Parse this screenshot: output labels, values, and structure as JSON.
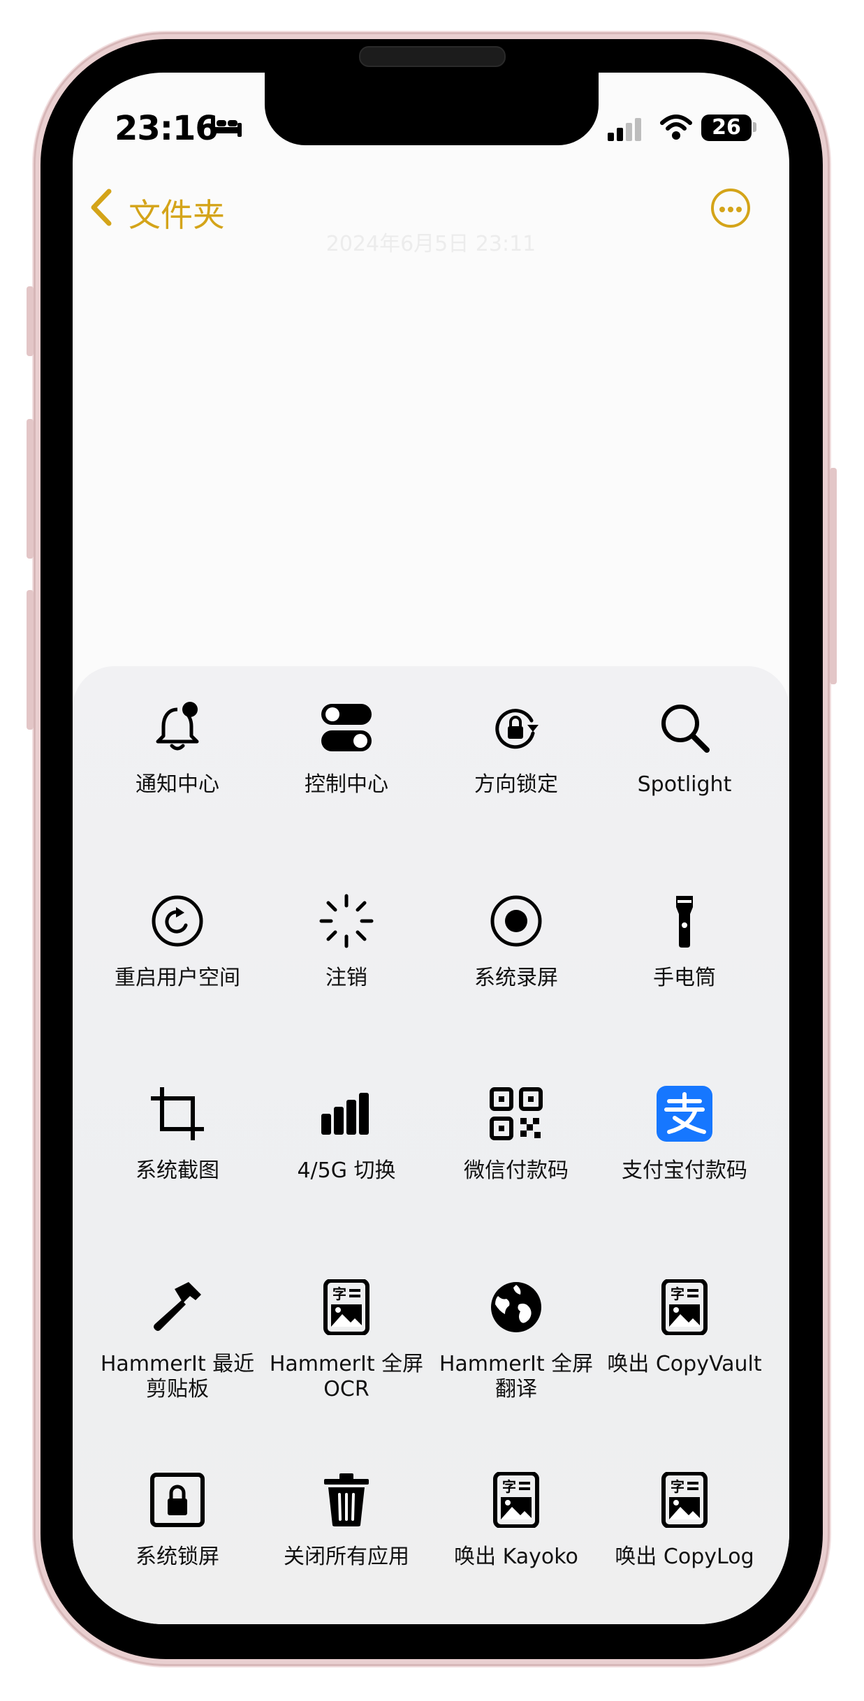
{
  "status_bar": {
    "time": "23:16",
    "battery": "26",
    "icons": [
      "bed-icon",
      "signal-icon",
      "wifi-icon",
      "battery-icon"
    ]
  },
  "nav": {
    "back_label": "文件夹",
    "more_icon": "ellipsis-circle-icon",
    "accent_color": "#d4a419"
  },
  "note": {
    "date": "2024年6月5日 23:11"
  },
  "shortcuts": [
    {
      "label": "通知中心",
      "icon": "bell-badge-icon"
    },
    {
      "label": "控制中心",
      "icon": "switches-icon"
    },
    {
      "label": "方向锁定",
      "icon": "rotation-lock-icon"
    },
    {
      "label": "Spotlight",
      "icon": "magnifier-icon"
    },
    {
      "label": "重启用户空间",
      "icon": "restart-icon"
    },
    {
      "label": "注销",
      "icon": "spinner-icon"
    },
    {
      "label": "系统录屏",
      "icon": "record-icon"
    },
    {
      "label": "手电筒",
      "icon": "flashlight-icon"
    },
    {
      "label": "系统截图",
      "icon": "crop-icon"
    },
    {
      "label": "4/5G 切换",
      "icon": "cellular-bars-icon"
    },
    {
      "label": "微信付款码",
      "icon": "qrcode-icon"
    },
    {
      "label": "支付宝付款码",
      "icon": "alipay-icon"
    },
    {
      "label": "HammerIt 最近\n剪贴板",
      "icon": "hammer-icon"
    },
    {
      "label": "HammerIt 全屏\nOCR",
      "icon": "text-image-icon"
    },
    {
      "label": "HammerIt 全屏\n翻译",
      "icon": "globe-icon"
    },
    {
      "label": "唤出 CopyVault",
      "icon": "text-image-icon"
    },
    {
      "label": "系统锁屏",
      "icon": "lock-screen-icon"
    },
    {
      "label": "关闭所有应用",
      "icon": "trash-icon"
    },
    {
      "label": "唤出 Kayoko",
      "icon": "text-image-icon"
    },
    {
      "label": "唤出 CopyLog",
      "icon": "text-image-icon"
    }
  ],
  "colors": {
    "alipay_blue": "#1677ff",
    "phone_frame": "#e9cfd0"
  }
}
